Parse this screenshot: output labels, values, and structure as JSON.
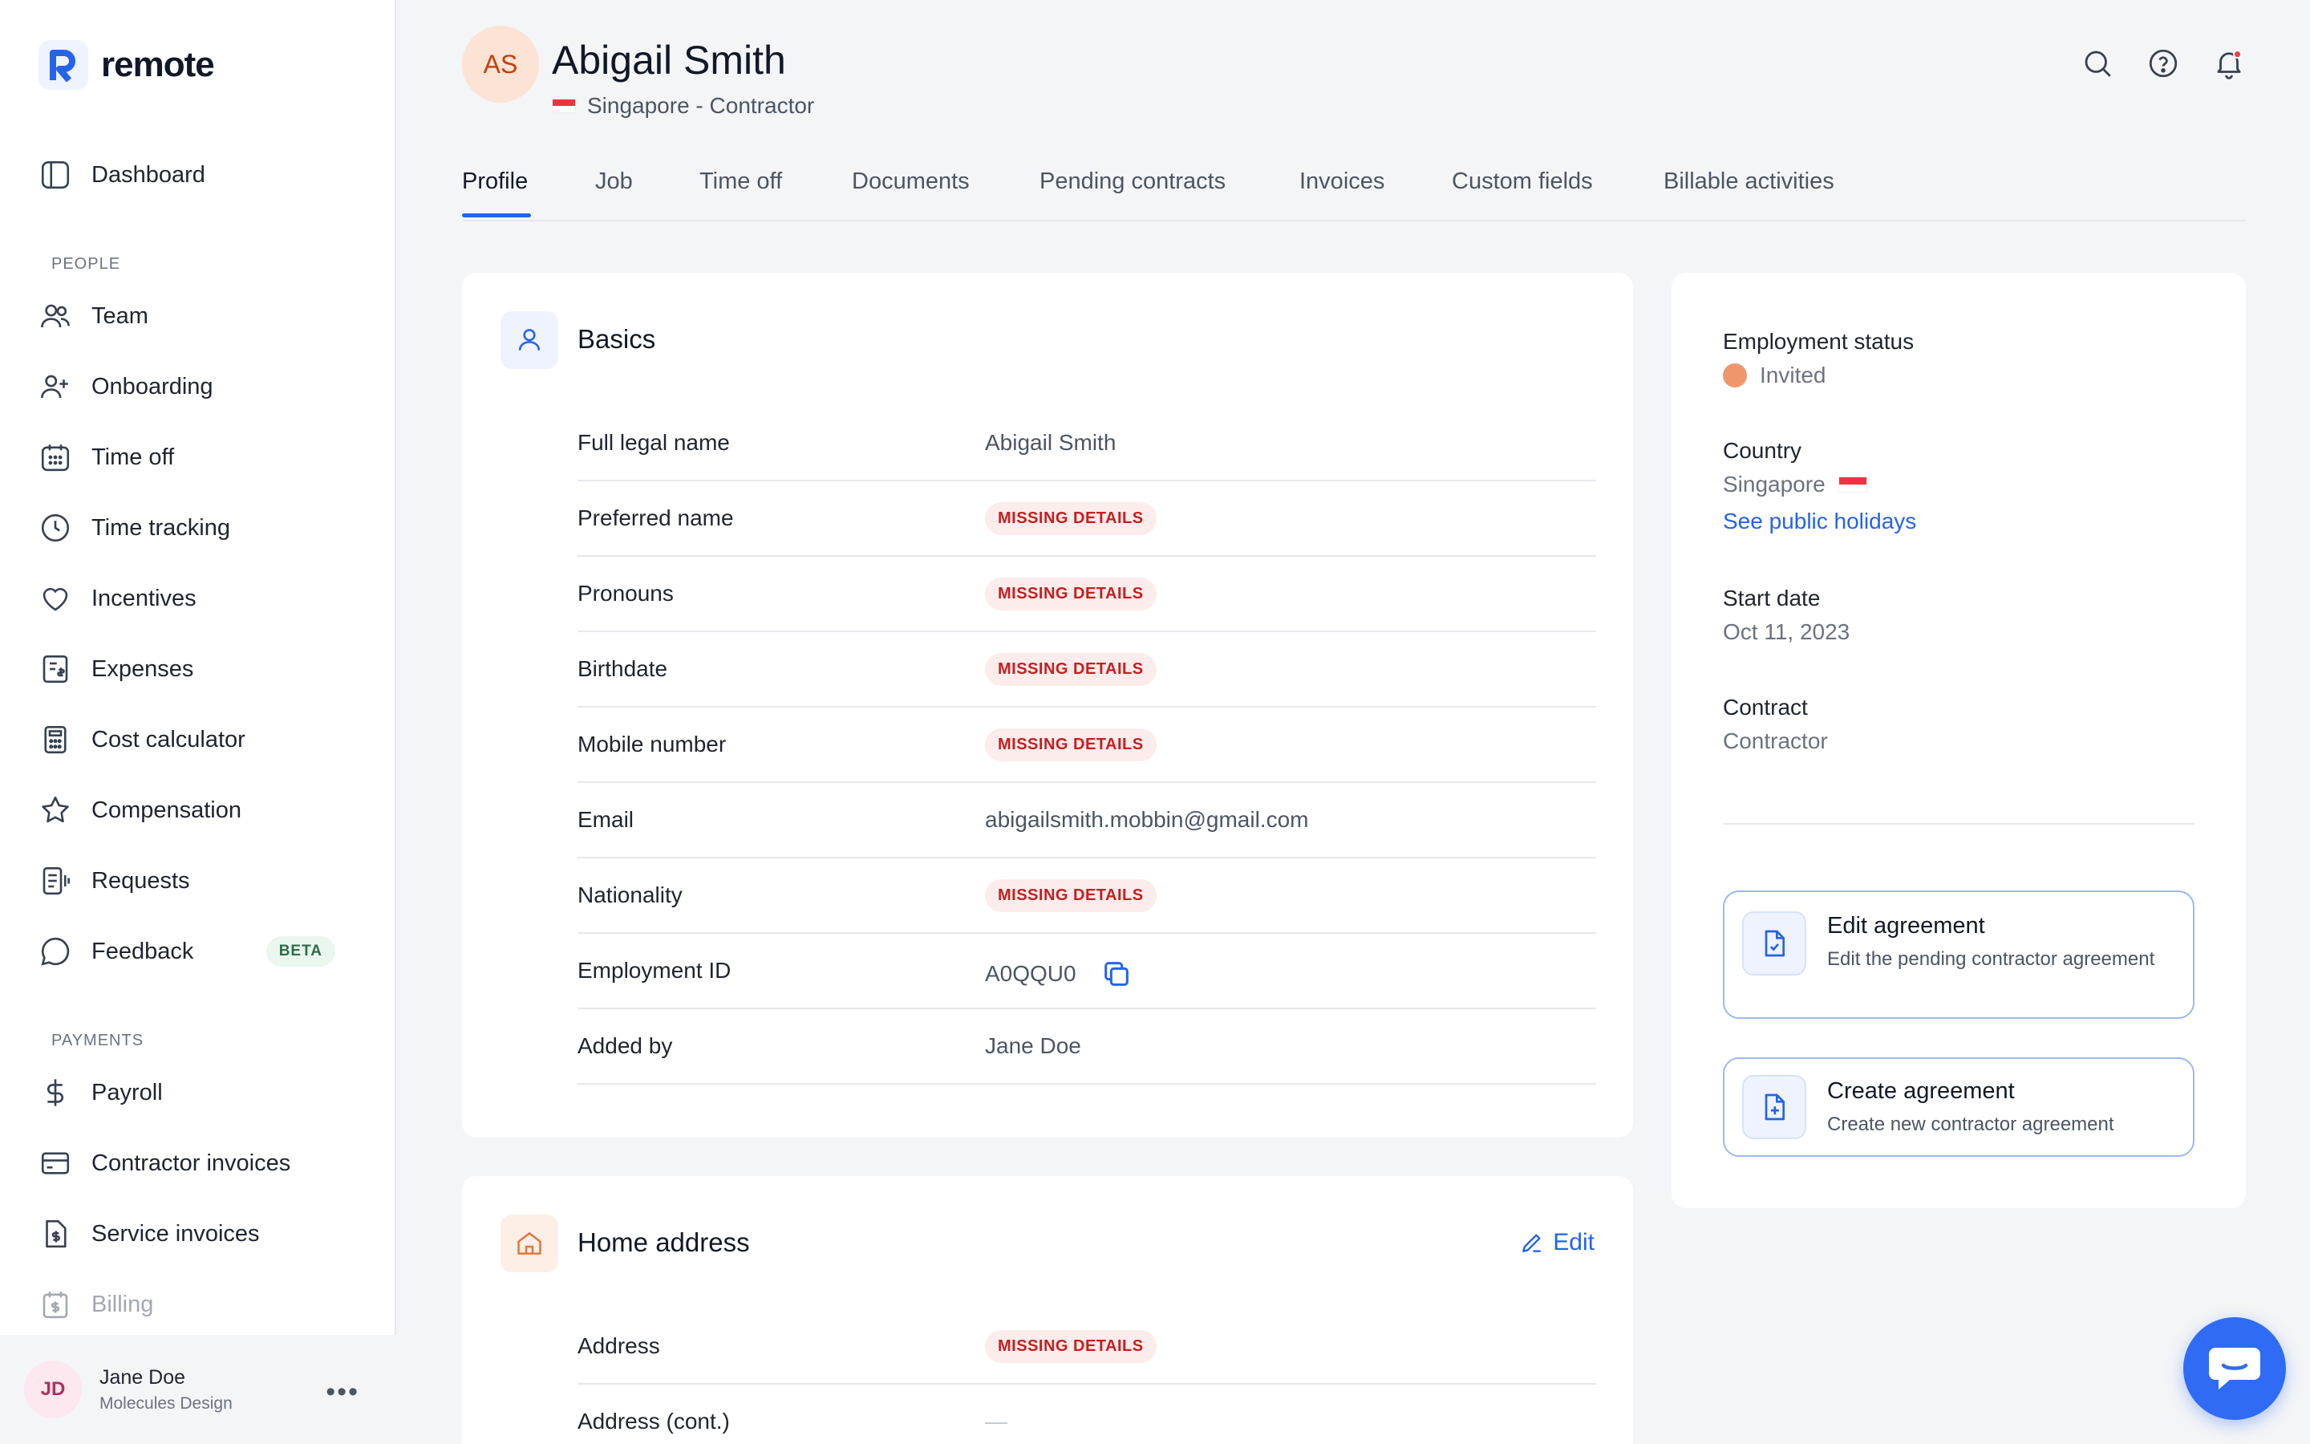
{
  "app": {
    "brand": "remote"
  },
  "sidebar": {
    "dashboard": "Dashboard",
    "people_label": "PEOPLE",
    "people": [
      "Team",
      "Onboarding",
      "Time off",
      "Time tracking",
      "Incentives",
      "Expenses",
      "Cost calculator",
      "Compensation",
      "Requests",
      "Feedback"
    ],
    "beta": "BETA",
    "payments_label": "PAYMENTS",
    "payments": [
      "Payroll",
      "Contractor invoices",
      "Service invoices",
      "Billing"
    ],
    "user": {
      "initials": "JD",
      "name": "Jane Doe",
      "org": "Molecules Design",
      "more": "•••"
    }
  },
  "header": {
    "initials": "AS",
    "name": "Abigail Smith",
    "subtitle": "Singapore - Contractor"
  },
  "tabs": [
    "Profile",
    "Job",
    "Time off",
    "Documents",
    "Pending contracts",
    "Invoices",
    "Custom fields",
    "Billable activities"
  ],
  "basics": {
    "title": "Basics",
    "missing_label": "MISSING DETAILS",
    "rows": [
      {
        "label": "Full legal name",
        "value": "Abigail Smith"
      },
      {
        "label": "Preferred name",
        "value": ""
      },
      {
        "label": "Pronouns",
        "value": ""
      },
      {
        "label": "Birthdate",
        "value": ""
      },
      {
        "label": "Mobile number",
        "value": ""
      },
      {
        "label": "Email",
        "value": "abigailsmith.mobbin@gmail.com"
      },
      {
        "label": "Nationality",
        "value": ""
      },
      {
        "label": "Employment ID",
        "value": "A0QQU0"
      },
      {
        "label": "Added by",
        "value": "Jane Doe"
      }
    ]
  },
  "home_address": {
    "title": "Home address",
    "edit": "Edit",
    "rows": [
      {
        "label": "Address",
        "value": ""
      },
      {
        "label": "Address (cont.)",
        "value": "—"
      }
    ]
  },
  "summary": {
    "employment_status_label": "Employment status",
    "employment_status": "Invited",
    "country_label": "Country",
    "country": "Singapore",
    "holidays_link": "See public holidays",
    "start_date_label": "Start date",
    "start_date": "Oct 11, 2023",
    "contract_label": "Contract",
    "contract": "Contractor",
    "actions": [
      {
        "title": "Edit agreement",
        "desc": "Edit the pending contractor agreement"
      },
      {
        "title": "Create agreement",
        "desc": "Create new contractor agreement"
      }
    ]
  },
  "colors": {
    "accent": "#2563eb",
    "missing_bg": "#fdecec",
    "missing_text": "#c81e1e",
    "status_invited": "#f0966c"
  }
}
